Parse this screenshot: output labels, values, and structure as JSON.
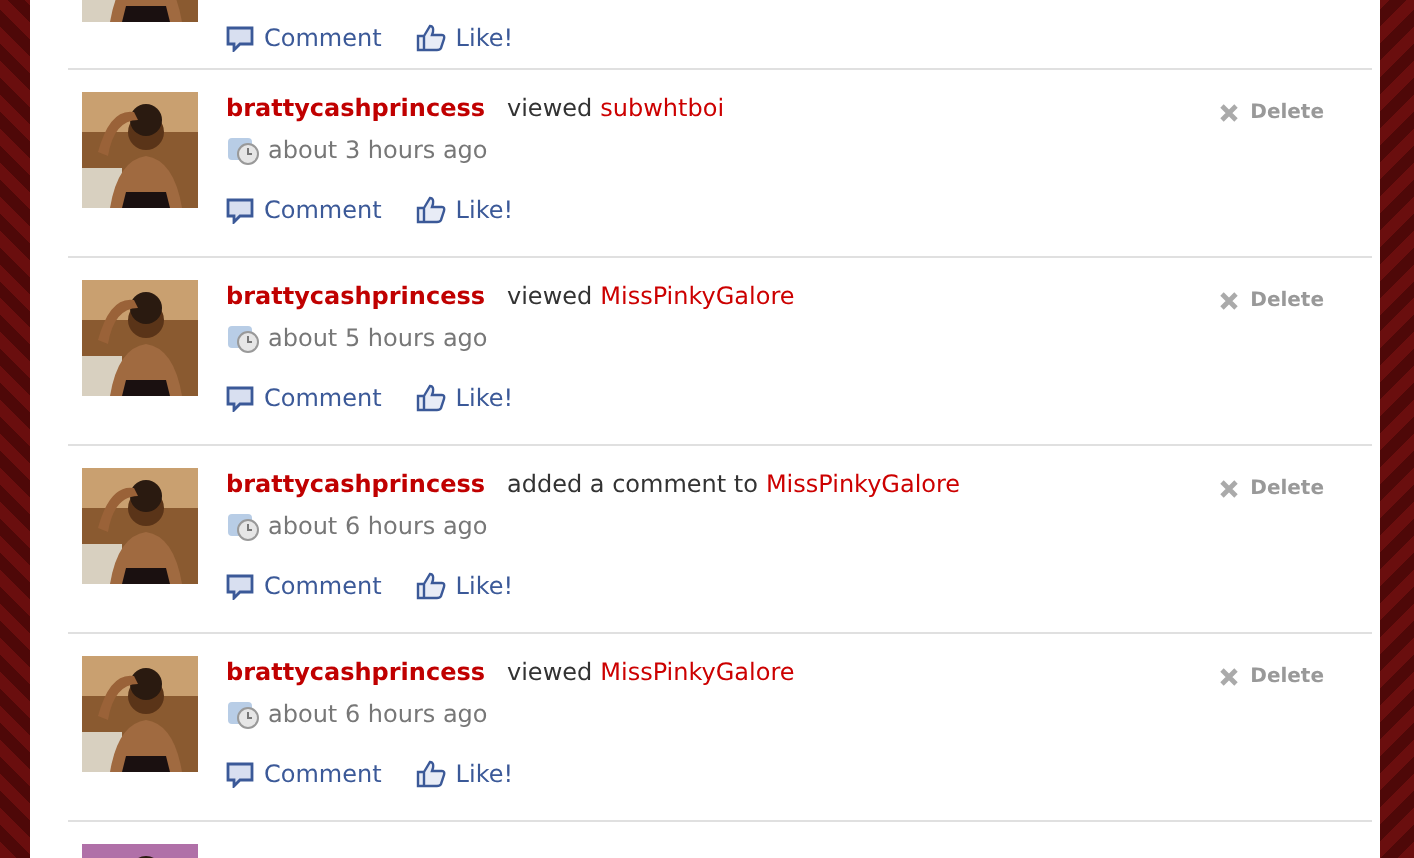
{
  "top_actions": {
    "comment": "Comment",
    "like": "Like!"
  },
  "items": [
    {
      "actor": "brattycashprincess",
      "verb": "viewed",
      "target": "subwhtboi",
      "time": "about 3 hours ago",
      "delete": "Delete",
      "comment": "Comment",
      "like": "Like!"
    },
    {
      "actor": "brattycashprincess",
      "verb": "viewed",
      "target": "MissPinkyGalore",
      "time": "about 5 hours ago",
      "delete": "Delete",
      "comment": "Comment",
      "like": "Like!"
    },
    {
      "actor": "brattycashprincess",
      "verb": "added a comment to",
      "target": "MissPinkyGalore",
      "time": "about 6 hours ago",
      "delete": "Delete",
      "comment": "Comment",
      "like": "Like!"
    },
    {
      "actor": "brattycashprincess",
      "verb": "viewed",
      "target": "MissPinkyGalore",
      "time": "about 6 hours ago",
      "delete": "Delete",
      "comment": "Comment",
      "like": "Like!"
    },
    {
      "kind": "picture"
    }
  ]
}
